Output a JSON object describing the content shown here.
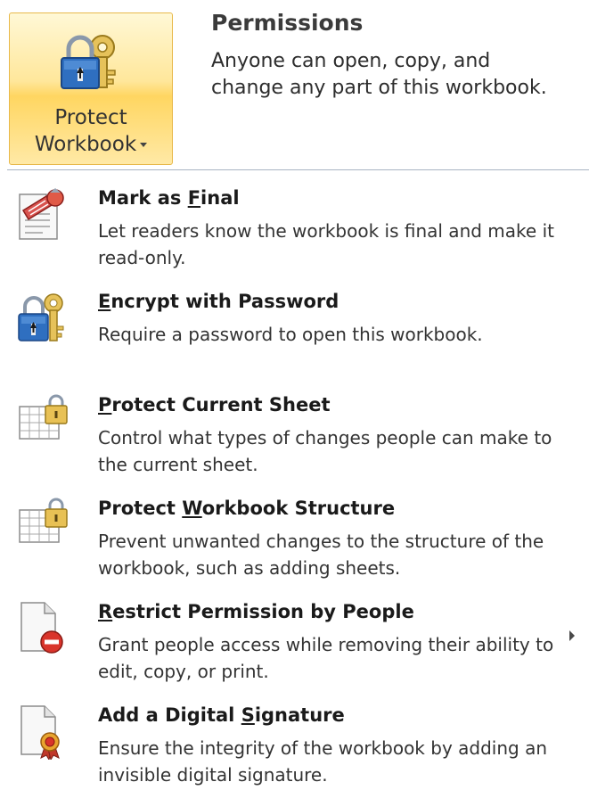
{
  "header": {
    "button_line1": "Protect",
    "button_line2": "Workbook",
    "permissions_title": "Permissions",
    "permissions_desc": "Anyone can open, copy, and change any part of this workbook."
  },
  "menu": {
    "items": [
      {
        "title_before": "Mark as ",
        "title_accel": "F",
        "title_after": "inal",
        "desc": "Let readers know the workbook is final and make it read-only.",
        "icon": "mark-final-icon"
      },
      {
        "title_before": "",
        "title_accel": "E",
        "title_after": "ncrypt with Password",
        "desc": "Require a password to open this workbook.",
        "icon": "lock-key-icon"
      },
      {
        "title_before": "",
        "title_accel": "P",
        "title_after": "rotect Current Sheet",
        "desc": "Control what types of changes people can make to the current sheet.",
        "icon": "sheet-lock-icon"
      },
      {
        "title_before": "Protect ",
        "title_accel": "W",
        "title_after": "orkbook Structure",
        "desc": "Prevent unwanted changes to the structure of the workbook, such as adding sheets.",
        "icon": "sheet-lock-icon"
      },
      {
        "title_before": "",
        "title_accel": "R",
        "title_after": "estrict Permission by People",
        "desc": "Grant people access while removing their ability to edit, copy, or print.",
        "icon": "restrict-permission-icon",
        "has_submenu": true
      },
      {
        "title_before": "Add a Digital ",
        "title_accel": "S",
        "title_after": "ignature",
        "desc": "Ensure the integrity of the workbook by adding an invisible digital signature.",
        "icon": "digital-signature-icon"
      }
    ]
  },
  "colors": {
    "button_highlight": "#ffe79b",
    "button_border": "#e8b94b",
    "divider": "#a8b3c2"
  }
}
